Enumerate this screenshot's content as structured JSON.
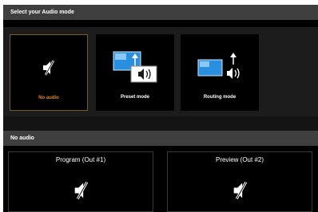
{
  "audio_mode_header": "Select your Audio mode",
  "modes": [
    {
      "label": "No audio",
      "icon": "speaker-muted-icon",
      "selected": true
    },
    {
      "label": "Preset mode",
      "icon": "preset-audio-icon",
      "selected": false
    },
    {
      "label": "Routing mode",
      "icon": "routing-audio-icon",
      "selected": false
    }
  ],
  "status_header": "No audio",
  "outputs": [
    {
      "label": "Program (Out #1)",
      "icon": "speaker-muted-icon"
    },
    {
      "label": "Preview (Out #2)",
      "icon": "speaker-muted-icon"
    }
  ],
  "colors": {
    "selected_accent": "#e08a1e",
    "header_bg": "#3f3f3f",
    "screen_blue": "#2b8fe0"
  }
}
